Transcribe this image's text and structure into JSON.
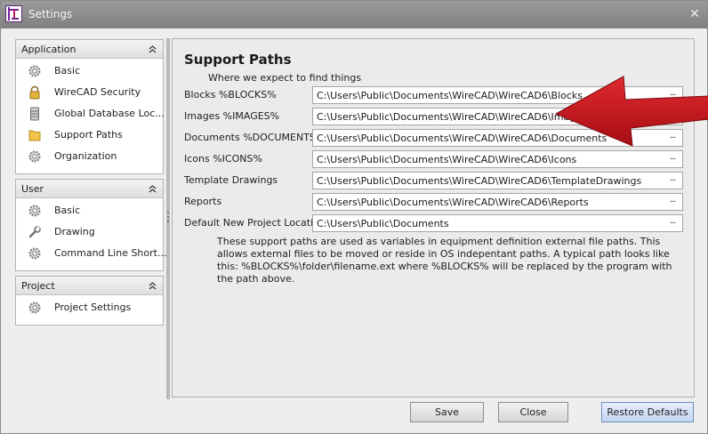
{
  "window": {
    "title": "Settings"
  },
  "nav": [
    {
      "header": "Application",
      "items": [
        {
          "label": "Basic",
          "icon": "gear-icon"
        },
        {
          "label": "WireCAD Security",
          "icon": "lock-icon"
        },
        {
          "label": "Global Database Loc...",
          "icon": "database-icon"
        },
        {
          "label": "Support Paths",
          "icon": "folder-icon"
        },
        {
          "label": "Organization",
          "icon": "gear-icon"
        }
      ]
    },
    {
      "header": "User",
      "items": [
        {
          "label": "Basic",
          "icon": "gear-icon"
        },
        {
          "label": "Drawing",
          "icon": "wrench-icon"
        },
        {
          "label": "Command Line Short...",
          "icon": "gear-icon"
        }
      ]
    },
    {
      "header": "Project",
      "items": [
        {
          "label": "Project Settings",
          "icon": "gear-icon"
        }
      ]
    }
  ],
  "content": {
    "title": "Support Paths",
    "subtitle": "Where we expect to find things",
    "paths": [
      {
        "label": "Blocks %BLOCKS%",
        "value": "C:\\Users\\Public\\Documents\\WireCAD\\WireCAD6\\Blocks"
      },
      {
        "label": "Images %IMAGES%",
        "value": "C:\\Users\\Public\\Documents\\WireCAD\\WireCAD6\\Images"
      },
      {
        "label": "Documents %DOCUMENTS%",
        "value": "C:\\Users\\Public\\Documents\\WireCAD\\WireCAD6\\Documents"
      },
      {
        "label": "Icons %ICONS%",
        "value": "C:\\Users\\Public\\Documents\\WireCAD\\WireCAD6\\Icons"
      },
      {
        "label": "Template Drawings",
        "value": "C:\\Users\\Public\\Documents\\WireCAD\\WireCAD6\\TemplateDrawings"
      },
      {
        "label": "Reports",
        "value": "C:\\Users\\Public\\Documents\\WireCAD\\WireCAD6\\Reports"
      },
      {
        "label": "Default New Project Location",
        "value": "C:\\Users\\Public\\Documents"
      }
    ],
    "browse_label": "...",
    "help_text": "These support paths are used as variables in equipment definition external file paths. This allows external files to be moved or reside in OS indepentant paths. A typical path looks like this: %BLOCKS%\\folder\\filename.ext where %BLOCKS% will be replaced by the program with the path above."
  },
  "buttons": {
    "save": "Save",
    "close": "Close",
    "restore": "Restore Defaults"
  },
  "colors": {
    "arrow": "#c1121b",
    "titlebar": "#8c8c8c",
    "primary_button": "#c4d6f2"
  }
}
